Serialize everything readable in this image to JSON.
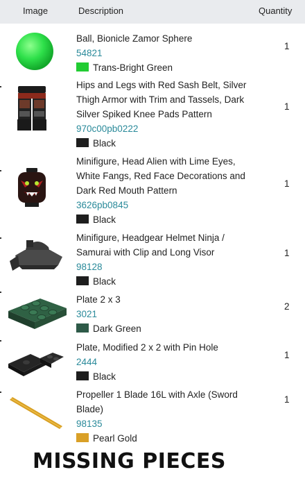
{
  "header": {
    "image_label": "Image",
    "description_label": "Description",
    "quantity_label": "Quantity"
  },
  "items": [
    {
      "name": "Ball, Bionicle Zamor Sphere",
      "code": "54821",
      "color_name": "Trans-Bright Green",
      "color_hex": "#22cc33",
      "qty": "1",
      "icon": "green-sphere-icon"
    },
    {
      "name": "Hips and Legs with Red Sash Belt, Silver Thigh Armor with Trim and Tassels, Dark Silver Spiked Knee Pads Pattern",
      "code": "970c00pb0222",
      "color_name": "Black",
      "color_hex": "#1e1e1e",
      "qty": "1",
      "icon": "minifig-legs-icon"
    },
    {
      "name": "Minifigure, Head Alien with Lime Eyes, White Fangs, Red Face Decorations and Dark Red Mouth Pattern",
      "code": "3626pb0845",
      "color_name": "Black",
      "color_hex": "#1e1e1e",
      "qty": "1",
      "icon": "minifig-head-icon"
    },
    {
      "name": "Minifigure, Headgear Helmet Ninja / Samurai with Clip and Long Visor",
      "code": "98128",
      "color_name": "Black",
      "color_hex": "#1e1e1e",
      "qty": "1",
      "icon": "samurai-helmet-icon"
    },
    {
      "name": "Plate 2 x 3",
      "code": "3021",
      "color_name": "Dark Green",
      "color_hex": "#2e5a48",
      "qty": "2",
      "icon": "plate-2x3-icon"
    },
    {
      "name": "Plate, Modified 2 x 2 with Pin Hole",
      "code": "2444",
      "color_name": "Black",
      "color_hex": "#1e1e1e",
      "qty": "1",
      "icon": "plate-pin-hole-icon"
    },
    {
      "name": "Propeller 1 Blade 16L with Axle (Sword Blade)",
      "code": "98135",
      "color_name": "Pearl Gold",
      "color_hex": "#d9a027",
      "qty": "1",
      "icon": "sword-blade-icon"
    }
  ],
  "footer": {
    "caption": "MISSING PIECES"
  }
}
